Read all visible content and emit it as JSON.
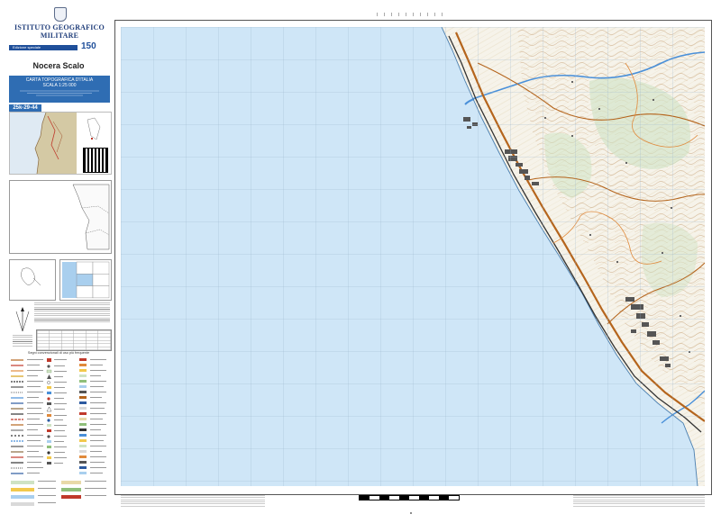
{
  "header": {
    "institute": "ISTITUTO GEOGRAFICO MILITARE",
    "edition": "Edizione speciale",
    "anniversary_logo": "150"
  },
  "sheet": {
    "title": "Nocera Scalo",
    "series": "CARTA TOPOGRAFICA D'ITALIA",
    "scale": "SCALA 1:25 000",
    "code": "25k-29-44"
  },
  "legend": {
    "title": "Segni convenzionali di uso più frequente"
  },
  "colors": {
    "sea": "#cfe6f7",
    "land": "#f6f3ea",
    "contour": "#c8a27a",
    "road_major": "#b5651d",
    "railway": "#333333",
    "urban": "#555555",
    "river": "#4a90d9",
    "vegetation": "#cfe3c4",
    "grid": "#9ab4cc",
    "brand": "#1f4f9a"
  },
  "icons": {
    "emblem": "republic-emblem-icon",
    "qr": "qr-code-icon",
    "north_arrow": "north-arrow-icon"
  }
}
